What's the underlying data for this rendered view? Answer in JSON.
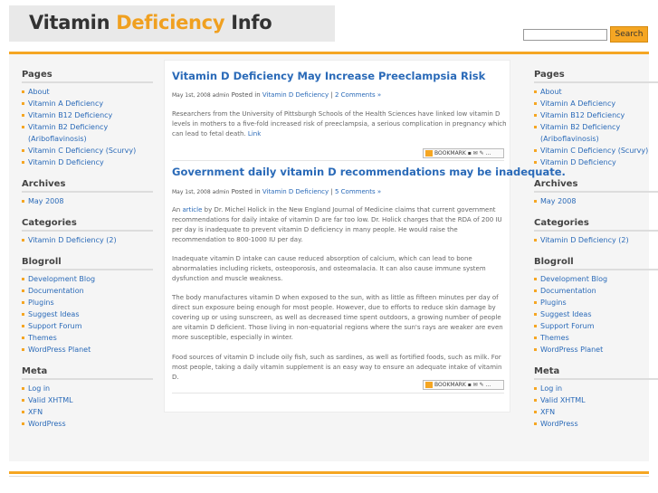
{
  "header": {
    "title_part1": "Vitamin ",
    "title_part2": "Deficiency",
    "title_part3": " Info",
    "search_button": "Search",
    "search_value": ""
  },
  "sidebar": {
    "pages_heading": "Pages",
    "pages": [
      "About",
      "Vitamin A Deficiency",
      "Vitamin B12 Deficiency",
      "Vitamin B2 Deficiency (Ariboflavinosis)",
      "Vitamin C Deficiency (Scurvy)",
      "Vitamin D Deficiency"
    ],
    "archives_heading": "Archives",
    "archives": [
      "May 2008"
    ],
    "categories_heading": "Categories",
    "categories": [
      "Vitamin D Deficiency (2)"
    ],
    "blogroll_heading": "Blogroll",
    "blogroll": [
      "Development Blog",
      "Documentation",
      "Plugins",
      "Suggest Ideas",
      "Support Forum",
      "Themes",
      "WordPress Planet"
    ],
    "meta_heading": "Meta",
    "meta": [
      "Log in",
      "Valid XHTML",
      "XFN",
      "WordPress"
    ]
  },
  "posts": [
    {
      "title": "Vitamin D Deficiency May Increase Preeclampsia Risk",
      "date": "May 1st, 2008 admin",
      "posted_in": " Posted in ",
      "category": "Vitamin D Deficiency",
      "divider": " | ",
      "comments": "2 Comments »",
      "body": "Researchers from the University of Pittsburgh Schools of the Health Sciences have linked low vitamin D levels in mothers to a five-fold increased risk of preeclampsia, a serious complication in pregnancy which can lead to fetal death.",
      "link": "Link",
      "bookmark": "BOOKMARK"
    },
    {
      "title": "Government daily vitamin D recommendations may be inadequate.",
      "date": "May 1st, 2008 admin",
      "posted_in": " Posted in ",
      "category": "Vitamin D Deficiency",
      "divider": " | ",
      "comments": "5 Comments »",
      "p1_pre": "An ",
      "p1_link": "article",
      "p1_post": " by Dr. Michel Holick in the New England Journal of Medicine claims that current government recommendations for daily intake of vitamin D are far too low. Dr. Holick charges that the RDA of 200 IU per day is inadequate to prevent vitamin D deficiency in many people. He would raise the recommendation to 800-1000 IU per day.",
      "p2": "Inadequate vitamin D intake can cause reduced absorption of calcium, which can lead to bone abnormalaties including rickets, osteoporosis, and osteomalacia. It can also cause immune system dysfunction and muscle weakness.",
      "p3": "The body manufactures vitamin D when exposed to the sun, with as little as fifteen minutes per day of direct sun exposure being enough for most people. However, due to efforts to reduce skin damage by covering up or using sunscreen, as well as decreased time spent outdoors, a growing number of people are vitamin D deficient. Those living in non-equatorial regions where the sun's rays are weaker are even more susceptible, especially in winter.",
      "p4": "Food sources of vitamin D include oily fish, such as sardines, as well as fortified foods, such as milk. For most people, taking a daily vitamin supplement is an easy way to ensure an adequate intake of vitamin D.",
      "bookmark": "BOOKMARK"
    }
  ],
  "colors": {
    "accent": "#f5a623",
    "link": "#2a6ab8",
    "band": "#f5f5f5"
  }
}
